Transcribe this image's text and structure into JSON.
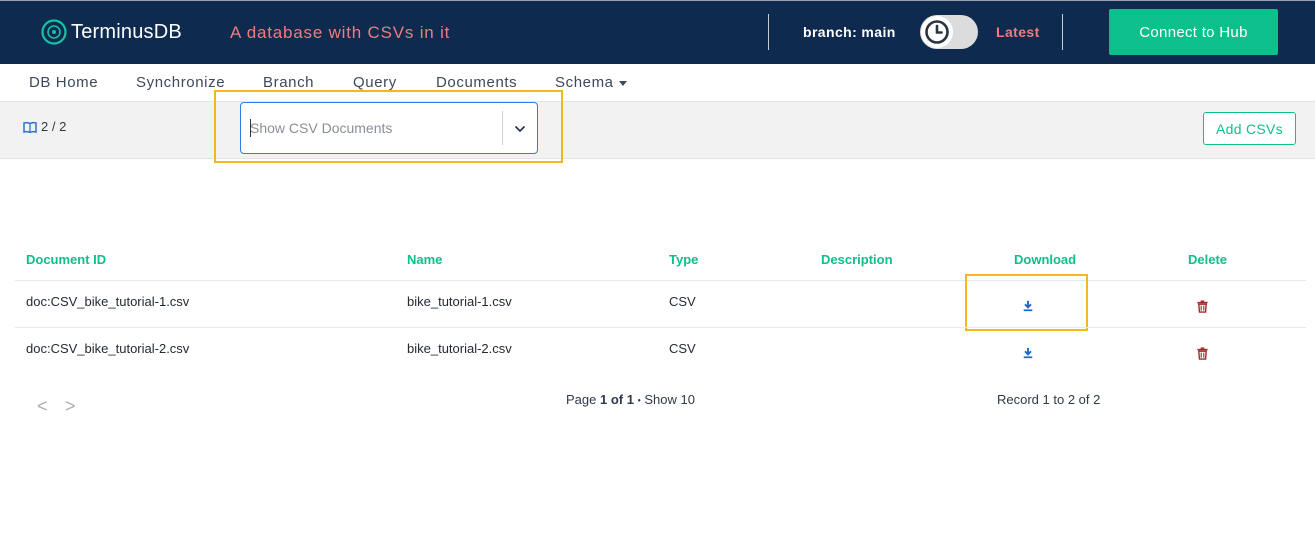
{
  "header": {
    "brand": "TerminusDB",
    "db_title": "A database with CSVs in it",
    "branch_label": "branch: main",
    "latest_label": "Latest",
    "connect_label": "Connect to Hub",
    "colors": {
      "bg": "#0e2a4f",
      "accent": "#0cc08b",
      "highlight": "#ef7c7c"
    }
  },
  "nav": {
    "items": [
      {
        "label": "DB Home"
      },
      {
        "label": "Synchronize"
      },
      {
        "label": "Branch"
      },
      {
        "label": "Query"
      },
      {
        "label": "Documents"
      },
      {
        "label": "Schema"
      }
    ]
  },
  "toolbar": {
    "count": "2 / 2",
    "select_placeholder": "Show CSV Documents",
    "add_label": "Add CSVs"
  },
  "table": {
    "headers": [
      "Document ID",
      "Name",
      "Type",
      "Description",
      "Download",
      "Delete"
    ],
    "rows": [
      {
        "id": "doc:CSV_bike_tutorial-1.csv",
        "name": "bike_tutorial-1.csv",
        "type": "CSV",
        "description": ""
      },
      {
        "id": "doc:CSV_bike_tutorial-2.csv",
        "name": "bike_tutorial-2.csv",
        "type": "CSV",
        "description": ""
      }
    ]
  },
  "pagination": {
    "prev": "<",
    "next": ">",
    "page_prefix": "Page ",
    "page_current": "1 of 1",
    "separator": "•",
    "show": "Show 10",
    "record": "Record 1 to 2 of 2"
  },
  "highlight_color": "#f5b720"
}
